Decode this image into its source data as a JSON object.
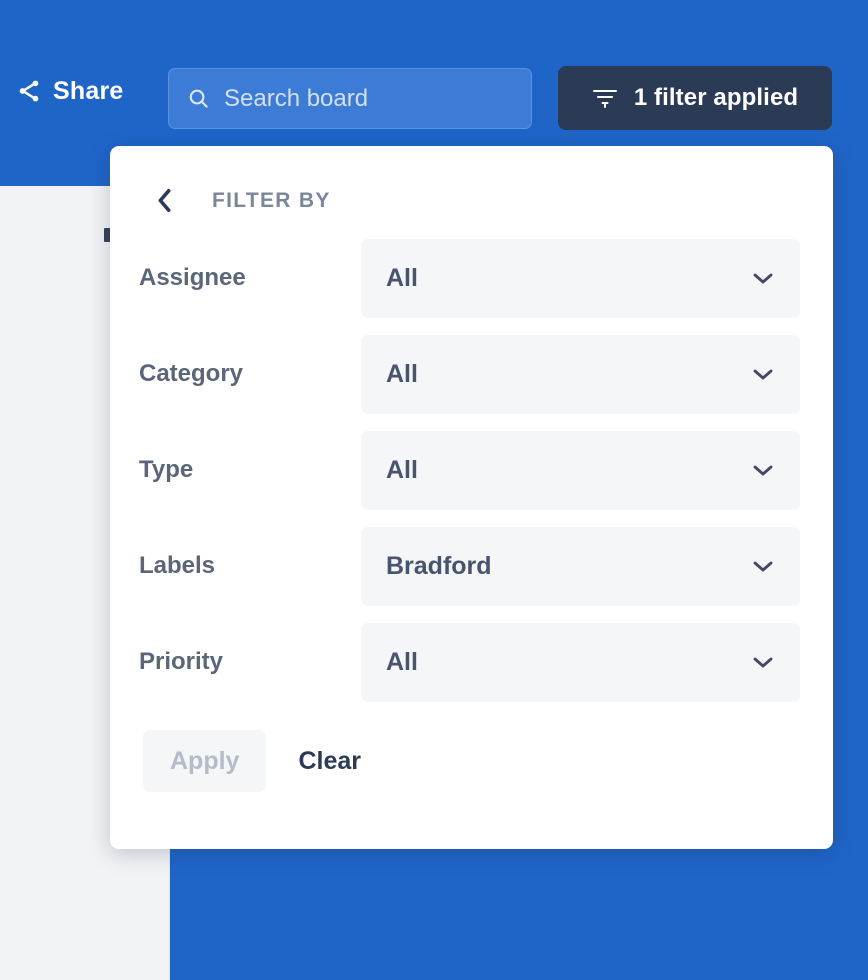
{
  "colors": {
    "brand_blue": "#1f65c8",
    "search_field": "#3c7bd6",
    "filter_button": "#2b3a55",
    "panel_bg": "#f1f3f5",
    "select_bg": "#f5f6f7",
    "text_dark": "#48546e",
    "label_muted": "#7b869b",
    "disabled_text": "#b4bcc9"
  },
  "topbar": {
    "share": {
      "label": "Share",
      "icon": "share-icon"
    },
    "search": {
      "icon": "search-icon",
      "placeholder": "Search board",
      "value": ""
    },
    "filter_button": {
      "icon": "filter-funnel-icon",
      "label": "1 filter applied",
      "count": 1,
      "active": true
    }
  },
  "filter_popup": {
    "back_icon": "chevron-left-icon",
    "title": "FILTER BY",
    "rows": [
      {
        "label": "Assignee",
        "value": "All",
        "icon": "chevron-down-icon"
      },
      {
        "label": "Category",
        "value": "All",
        "icon": "chevron-down-icon"
      },
      {
        "label": "Type",
        "value": "All",
        "icon": "chevron-down-icon"
      },
      {
        "label": "Labels",
        "value": "Bradford",
        "icon": "chevron-down-icon"
      },
      {
        "label": "Priority",
        "value": "All",
        "icon": "chevron-down-icon"
      }
    ],
    "actions": {
      "apply_label": "Apply",
      "apply_disabled": true,
      "clear_label": "Clear"
    }
  }
}
